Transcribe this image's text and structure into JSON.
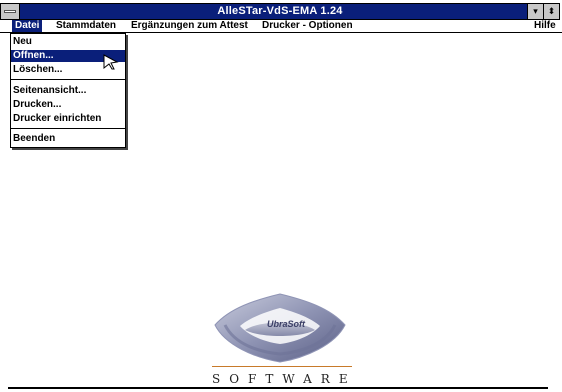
{
  "window": {
    "title": "AlleSTar-VdS-EMA 1.24"
  },
  "controls": {
    "minimize": "▾",
    "maximize": "⬍"
  },
  "menu": {
    "items": [
      "Datei",
      "Stammdaten",
      "Ergänzungen zum Attest",
      "Drucker - Optionen",
      "Hilfe"
    ]
  },
  "dropdown": {
    "items": [
      "Neu",
      "Öffnen...",
      "Löschen...",
      "Seitenansicht...",
      "Drucken...",
      "Drucker einrichten",
      "Beenden"
    ]
  },
  "logo": {
    "emblem_text": "UbraSoft",
    "brand": "SOFTWARE"
  },
  "colors": {
    "titlebar": "#0a1f7a",
    "highlight": "#0a1f7a"
  }
}
